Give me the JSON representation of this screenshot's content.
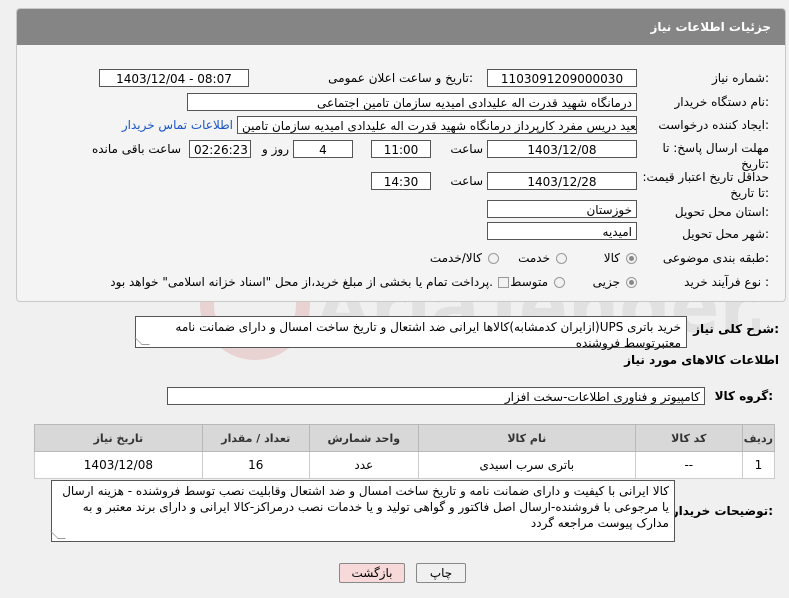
{
  "panel": {
    "title": "جزئیات اطلاعات نیاز"
  },
  "form": {
    "need_number_label": "شماره نیاز:",
    "need_number": "1103091209000030",
    "announce_label": "تاریخ و ساعت اعلان عمومی:",
    "announce_value": "1403/12/04 - 08:07",
    "buyer_org_label": "نام دستگاه خریدار:",
    "buyer_org": "درمانگاه شهید قدرت اله علیدادی امیدیه سازمان تامین اجتماعی",
    "creator_label": "ایجاد کننده درخواست:",
    "creator": "سعید دریس مفرد کارپرداز درمانگاه شهید قدرت اله علیدادی امیدیه سازمان تامین",
    "contact_link": "اطلاعات تماس خریدار",
    "reply_deadline_label": "مهلت ارسال پاسخ: تا تاریخ:",
    "reply_date": "1403/12/08",
    "time_label": "ساعت",
    "reply_time": "11:00",
    "days_value": "4",
    "days_label": "روز و",
    "remaining_time": "02:26:23",
    "remaining_label": "ساعت باقی مانده",
    "price_validity_label": "حداقل تاریخ اعتبار قیمت: تا تاریخ:",
    "price_date": "1403/12/28",
    "price_time": "14:30",
    "province_label": "استان محل تحویل:",
    "province": "خوزستان",
    "city_label": "شهر محل تحویل:",
    "city": "امیدیه",
    "category_label": "طبقه بندی موضوعی:",
    "category_options": [
      "کالا",
      "خدمت",
      "کالا/خدمت"
    ],
    "process_label": "نوع فرآیند خرید :",
    "process_options": [
      "جزیی",
      "متوسط"
    ],
    "payment_text": "پرداخت تمام یا بخشی از مبلغ خرید،از محل \"اسناد خزانه اسلامی\" خواهد بود."
  },
  "summary": {
    "label": "شرح کلی نیاز:",
    "text": "خرید باتری UPS(ازایران کدمشابه)کالاها ایرانی ضد اشتعال و تاریخ ساخت امسال و دارای ضمانت نامه معتبرتوسط فروشنده"
  },
  "goods": {
    "section_title": "اطلاعات کالاهای مورد نیاز",
    "group_label": "گروه کالا:",
    "group_value": "کامپیوتر و فناوری اطلاعات-سخت افزار",
    "columns": [
      "ردیف",
      "کد کالا",
      "نام کالا",
      "واحد شمارش",
      "تعداد / مقدار",
      "تاریخ نیاز"
    ],
    "rows": [
      [
        "1",
        "--",
        "باتری سرب اسیدی",
        "عدد",
        "16",
        "1403/12/08"
      ]
    ]
  },
  "buyer_notes": {
    "label": "توضیحات خریدار:",
    "text": "کالا ایرانی با کیفیت و دارای ضمانت نامه و تاریخ ساخت امسال و ضد اشتعال وقابلیت نصب توسط فروشنده - هزینه ارسال یا مرجوعی با فروشنده-ارسال اصل فاکتور و گواهی تولید و یا خدمات نصب درمراکز-کالا ایرانی و دارای برند معتبر و به مدارک پیوست مراجعه گردد"
  },
  "buttons": {
    "print": "چاپ",
    "back": "بازگشت"
  },
  "watermark": {
    "text": "AriaTender.net"
  },
  "colors": {
    "header": "#858585",
    "link": "#1a55c5",
    "back_button": "#f7d9d9"
  }
}
